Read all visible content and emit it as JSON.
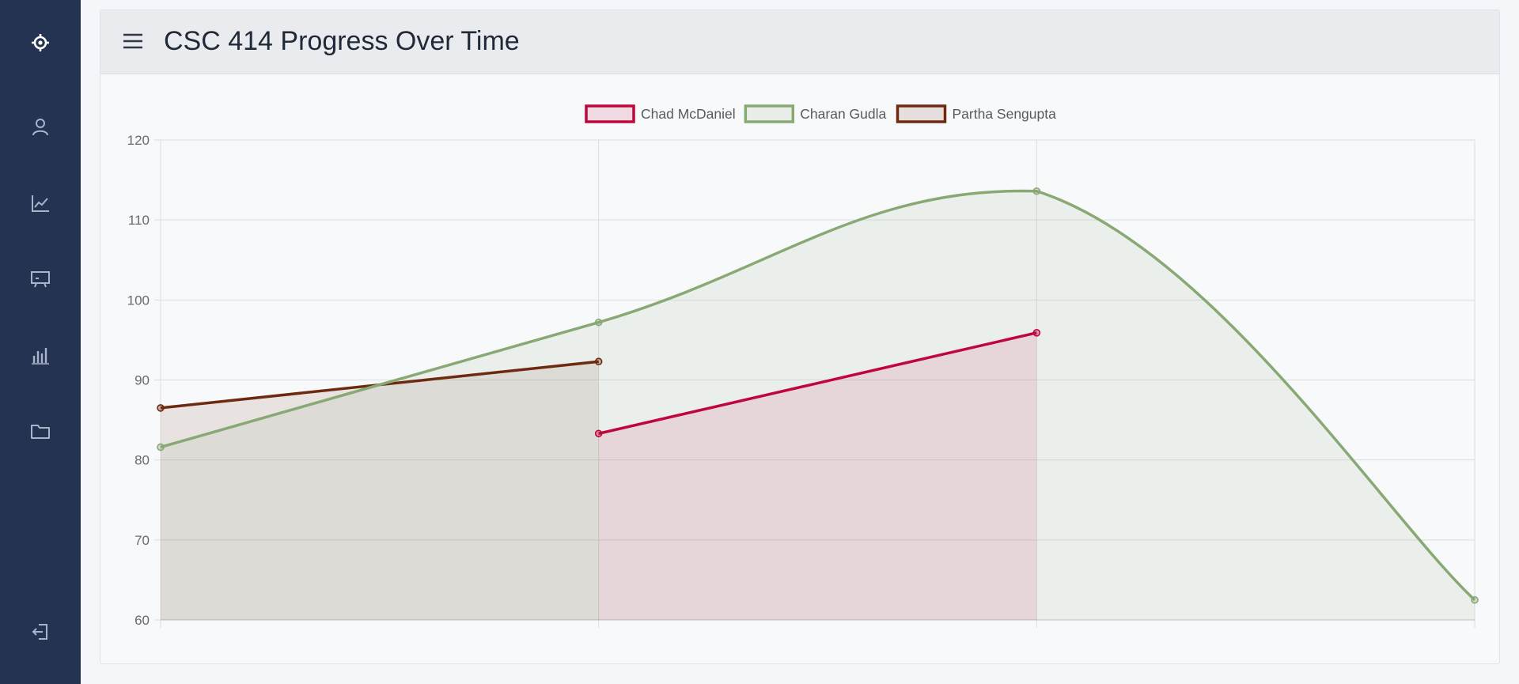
{
  "sidebar": {
    "items": [
      {
        "icon": "target-icon"
      },
      {
        "icon": "user-icon"
      },
      {
        "icon": "line-chart-icon"
      },
      {
        "icon": "presentation-icon"
      },
      {
        "icon": "bar-chart-icon"
      },
      {
        "icon": "folder-icon"
      }
    ],
    "logout_icon": "logout-icon"
  },
  "header": {
    "title": "CSC 414 Progress Over Time"
  },
  "chart_data": {
    "type": "line",
    "filled": true,
    "x": [
      1,
      2,
      3,
      4
    ],
    "ylim": [
      60,
      120
    ],
    "yticks": [
      60,
      70,
      80,
      90,
      100,
      110,
      120
    ],
    "grid": true,
    "legend_position": "top-center",
    "series": [
      {
        "name": "Chad McDaniel",
        "color": "#c0073d",
        "values": [
          null,
          83.3,
          95.9,
          null
        ]
      },
      {
        "name": "Charan Gudla",
        "color": "#88a874",
        "values": [
          81.6,
          97.2,
          113.6,
          62.5
        ]
      },
      {
        "name": "Partha Sengupta",
        "color": "#6e2a10",
        "values": [
          86.5,
          92.3,
          null,
          null
        ]
      }
    ]
  }
}
